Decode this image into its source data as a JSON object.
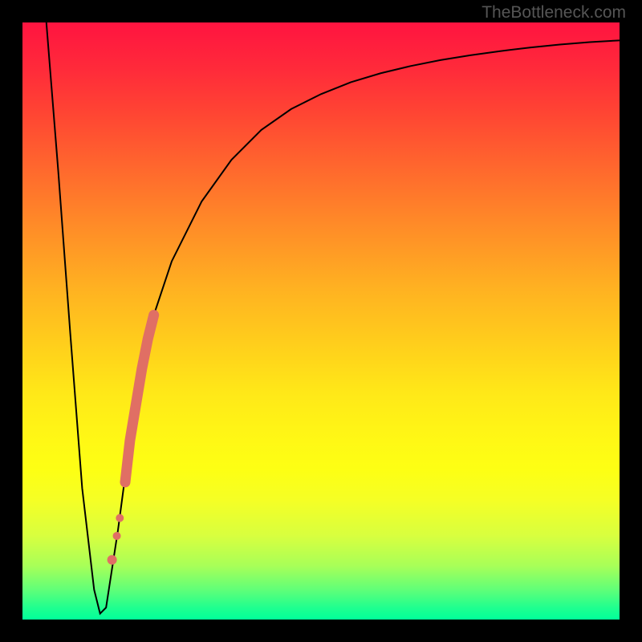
{
  "watermark": "TheBottleneck.com",
  "chart_data": {
    "type": "line",
    "title": "",
    "xlabel": "",
    "ylabel": "",
    "xlim": [
      0,
      100
    ],
    "ylim": [
      0,
      100
    ],
    "series": [
      {
        "name": "bottleneck-curve",
        "x": [
          4,
          6,
          8,
          10,
          12,
          13,
          14,
          16,
          18,
          20,
          22,
          25,
          30,
          35,
          40,
          45,
          50,
          55,
          60,
          65,
          70,
          75,
          80,
          85,
          90,
          95,
          100
        ],
        "y": [
          100,
          75,
          48,
          22,
          5,
          1,
          2,
          15,
          30,
          42,
          51,
          60,
          70,
          77,
          82,
          85.5,
          88,
          90,
          91.5,
          92.7,
          93.7,
          94.5,
          95.2,
          95.8,
          96.3,
          96.7,
          97
        ]
      }
    ],
    "markers": {
      "name": "highlight-segment",
      "color": "#e06f64",
      "points": [
        {
          "x": 15.0,
          "y": 10
        },
        {
          "x": 15.8,
          "y": 14
        },
        {
          "x": 16.3,
          "y": 17
        },
        {
          "x": 17.2,
          "y": 23
        },
        {
          "x": 18.0,
          "y": 30
        },
        {
          "x": 19.0,
          "y": 36
        },
        {
          "x": 20.0,
          "y": 42
        },
        {
          "x": 21.0,
          "y": 47
        },
        {
          "x": 22.0,
          "y": 51
        }
      ]
    }
  }
}
